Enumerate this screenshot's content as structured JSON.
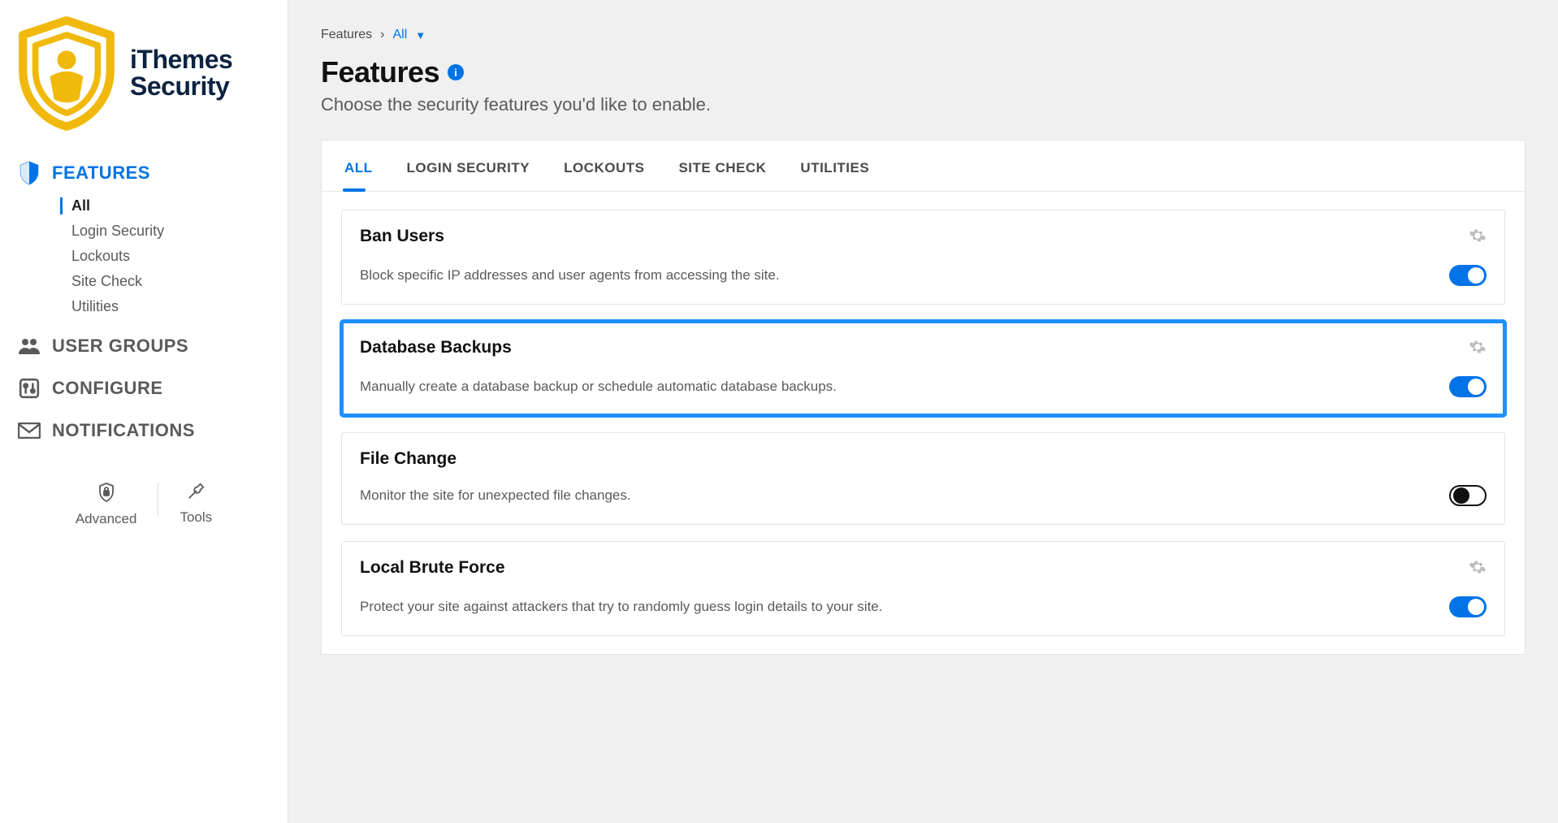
{
  "brand": {
    "line1": "iThemes",
    "line2": "Security"
  },
  "sidebar": {
    "items": [
      {
        "key": "features",
        "label": "FEATURES",
        "active": true
      },
      {
        "key": "user-groups",
        "label": "USER GROUPS"
      },
      {
        "key": "configure",
        "label": "CONFIGURE"
      },
      {
        "key": "notifications",
        "label": "NOTIFICATIONS"
      }
    ],
    "sub_features": [
      {
        "label": "All",
        "active": true
      },
      {
        "label": "Login Security"
      },
      {
        "label": "Lockouts"
      },
      {
        "label": "Site Check"
      },
      {
        "label": "Utilities"
      }
    ],
    "footer": {
      "advanced": "Advanced",
      "tools": "Tools"
    }
  },
  "breadcrumb": {
    "root": "Features",
    "current": "All"
  },
  "page": {
    "title": "Features",
    "description": "Choose the security features you'd like to enable."
  },
  "tabs": [
    {
      "label": "ALL",
      "active": true
    },
    {
      "label": "LOGIN SECURITY"
    },
    {
      "label": "LOCKOUTS"
    },
    {
      "label": "SITE CHECK"
    },
    {
      "label": "UTILITIES"
    }
  ],
  "features": [
    {
      "title": "Ban Users",
      "desc": "Block specific IP addresses and user agents from accessing the site.",
      "on": true,
      "gear": true,
      "highlight": false
    },
    {
      "title": "Database Backups",
      "desc": "Manually create a database backup or schedule automatic database backups.",
      "on": true,
      "gear": true,
      "highlight": true
    },
    {
      "title": "File Change",
      "desc": "Monitor the site for unexpected file changes.",
      "on": false,
      "gear": false,
      "highlight": false
    },
    {
      "title": "Local Brute Force",
      "desc": "Protect your site against attackers that try to randomly guess login details to your site.",
      "on": true,
      "gear": true,
      "highlight": false
    }
  ],
  "colors": {
    "accent": "#0073e6",
    "highlight": "#1e90ff",
    "gold": "#f0b90b"
  }
}
